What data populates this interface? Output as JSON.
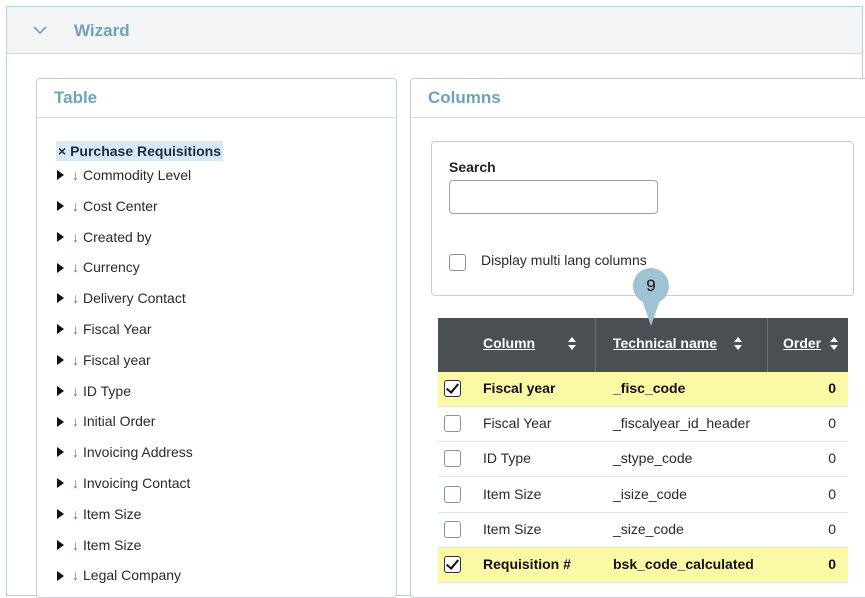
{
  "wizard": {
    "title": "Wizard"
  },
  "table_panel": {
    "title": "Table",
    "root": "× Purchase Requisitions",
    "items": [
      "Commodity Level",
      "Cost Center",
      "Created by",
      "Currency",
      "Delivery Contact",
      "Fiscal Year",
      "Fiscal year",
      "ID Type",
      "Initial Order",
      "Invoicing Address",
      "Invoicing Contact",
      "Item Size",
      "Item Size",
      "Legal Company"
    ]
  },
  "columns_panel": {
    "title": "Columns",
    "search_label": "Search",
    "search_value": "",
    "multi_lang_label": "Display multi lang columns",
    "multi_lang_checked": false,
    "headers": {
      "column": "Column",
      "technical_name": "Technical name",
      "order": "Order"
    },
    "rows": [
      {
        "checked": true,
        "highlighted": true,
        "column": "Fiscal year",
        "technical_name": "_fisc_code",
        "order": "0"
      },
      {
        "checked": false,
        "highlighted": false,
        "column": "Fiscal Year",
        "technical_name": "_fiscalyear_id_header",
        "order": "0"
      },
      {
        "checked": false,
        "highlighted": false,
        "column": "ID Type",
        "technical_name": "_stype_code",
        "order": "0"
      },
      {
        "checked": false,
        "highlighted": false,
        "column": "Item Size",
        "technical_name": "_isize_code",
        "order": "0"
      },
      {
        "checked": false,
        "highlighted": false,
        "column": "Item Size",
        "technical_name": "_size_code",
        "order": "0"
      },
      {
        "checked": true,
        "highlighted": true,
        "column": "Requisition #",
        "technical_name": "bsk_code_calculated",
        "order": "0"
      }
    ]
  },
  "callout": {
    "number": "9"
  },
  "colors": {
    "accent": "#6fa3b9",
    "header_bg": "#4a4f54",
    "highlight": "#fcf9a4",
    "tree_arrow": "#2a9d4a",
    "callout": "#9fc3d2"
  }
}
